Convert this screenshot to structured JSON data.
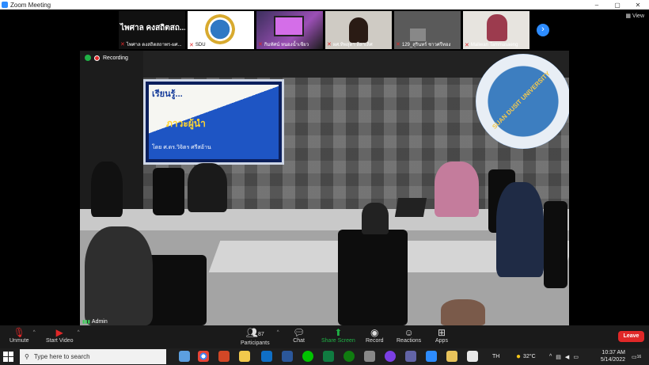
{
  "window": {
    "title": "Zoom Meeting",
    "minimize": "–",
    "maximize": "▢",
    "close": "✕"
  },
  "strip": {
    "view_label": "View",
    "next_label": "›",
    "tiles": [
      {
        "name": "ไพศาล ดงสถิตสถาพร-ผศ...",
        "display_text": "ไพศาล คงสถิตสถ..."
      },
      {
        "name": "SDU"
      },
      {
        "name": "กิมทัศน์ หนองน้ำเชียว"
      },
      {
        "name": "ผศ.ทิพสุดา ลีลาเลิศ"
      },
      {
        "name": "129_สุรินทร์ ชาวศรีทอง"
      },
      {
        "name": "Maliwan Tammasaeng"
      }
    ]
  },
  "video": {
    "recording_label": "Recording",
    "participant_name": "Admin",
    "logo_text": "SUAN DUSIT UNIVERSITY",
    "screen_line1": "เรียนรู้...",
    "screen_line2": "ภาวะผู้นำ",
    "screen_line3": "โดย ศ.ดร.วิจิตร ศรีสอ้าน"
  },
  "toolbar": {
    "unmute": "Unmute",
    "start_video": "Start Video",
    "participants": "Participants",
    "participants_count": "87",
    "chat": "Chat",
    "share_screen": "Share Screen",
    "record": "Record",
    "reactions": "Reactions",
    "apps": "Apps",
    "leave": "Leave"
  },
  "taskbar": {
    "search_placeholder": "Type here to search",
    "lang": "TH",
    "temperature": "32°C",
    "time": "10:37 AM",
    "date": "5/14/2022",
    "notification_count": "16"
  },
  "colors": {
    "zoom_blue": "#2d8cff",
    "leave_red": "#e02828",
    "share_green": "#20b146"
  }
}
